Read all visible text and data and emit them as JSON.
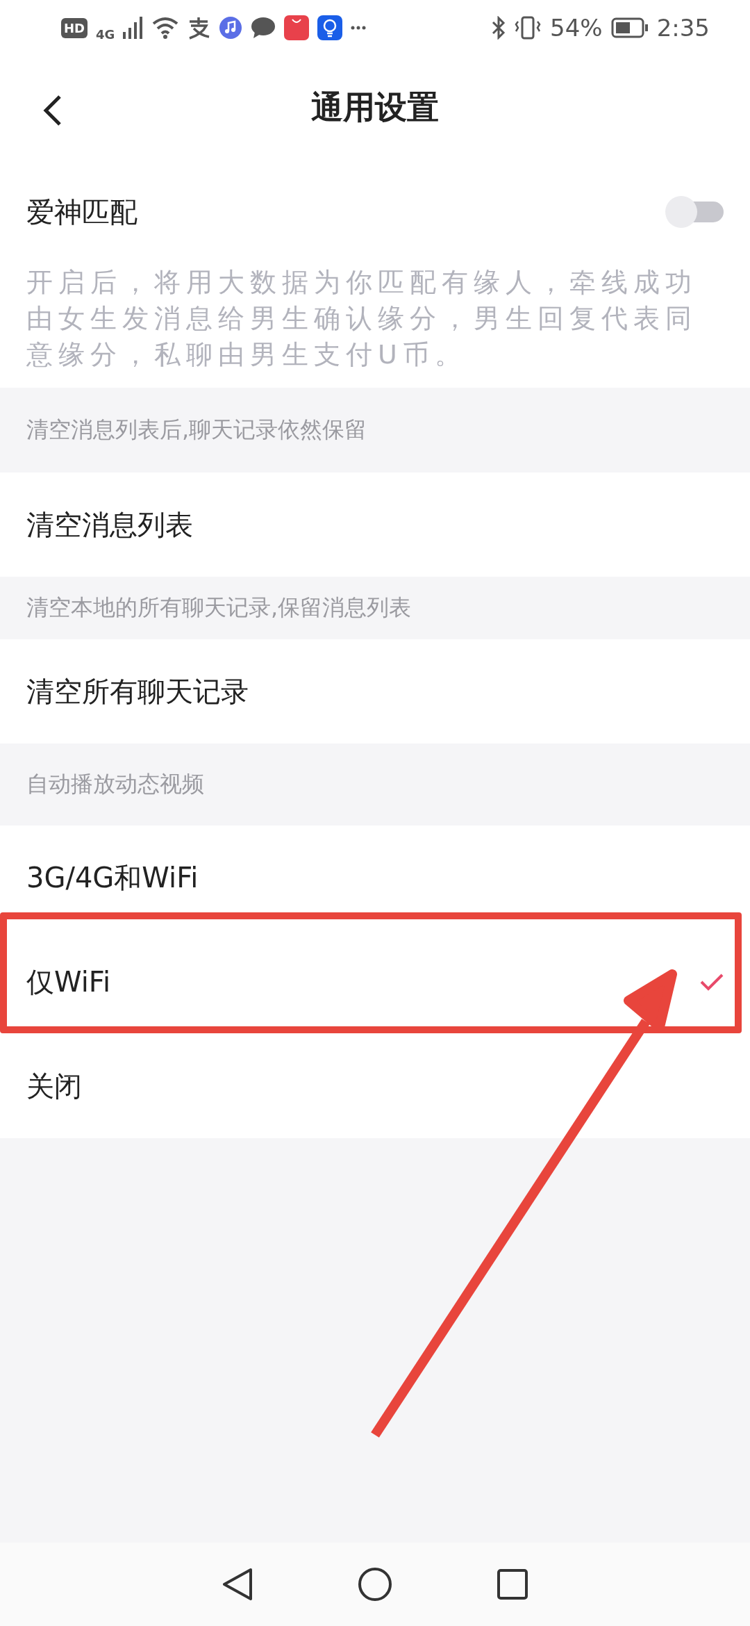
{
  "status_bar": {
    "network_badge": "HD",
    "network_type": "4G",
    "battery_percent": "54%",
    "time": "2:35"
  },
  "header": {
    "title": "通用设置"
  },
  "match_setting": {
    "label": "爱神匹配",
    "on": false,
    "description": "开启后，将用大数据为你匹配有缘人，牵线成功由女生发消息给男生确认缘分，男生回复代表同意缘分，私聊由男生支付U币。"
  },
  "sections": [
    {
      "header": "清空消息列表后,聊天记录依然保留",
      "items": [
        {
          "label": "清空消息列表"
        }
      ]
    },
    {
      "header": "清空本地的所有聊天记录,保留消息列表",
      "items": [
        {
          "label": "清空所有聊天记录"
        }
      ]
    }
  ],
  "autoplay": {
    "header": "自动播放动态视频",
    "options": [
      {
        "label": "3G/4G和WiFi",
        "selected": false
      },
      {
        "label": "仅WiFi",
        "selected": true
      },
      {
        "label": "关闭",
        "selected": false
      }
    ]
  }
}
